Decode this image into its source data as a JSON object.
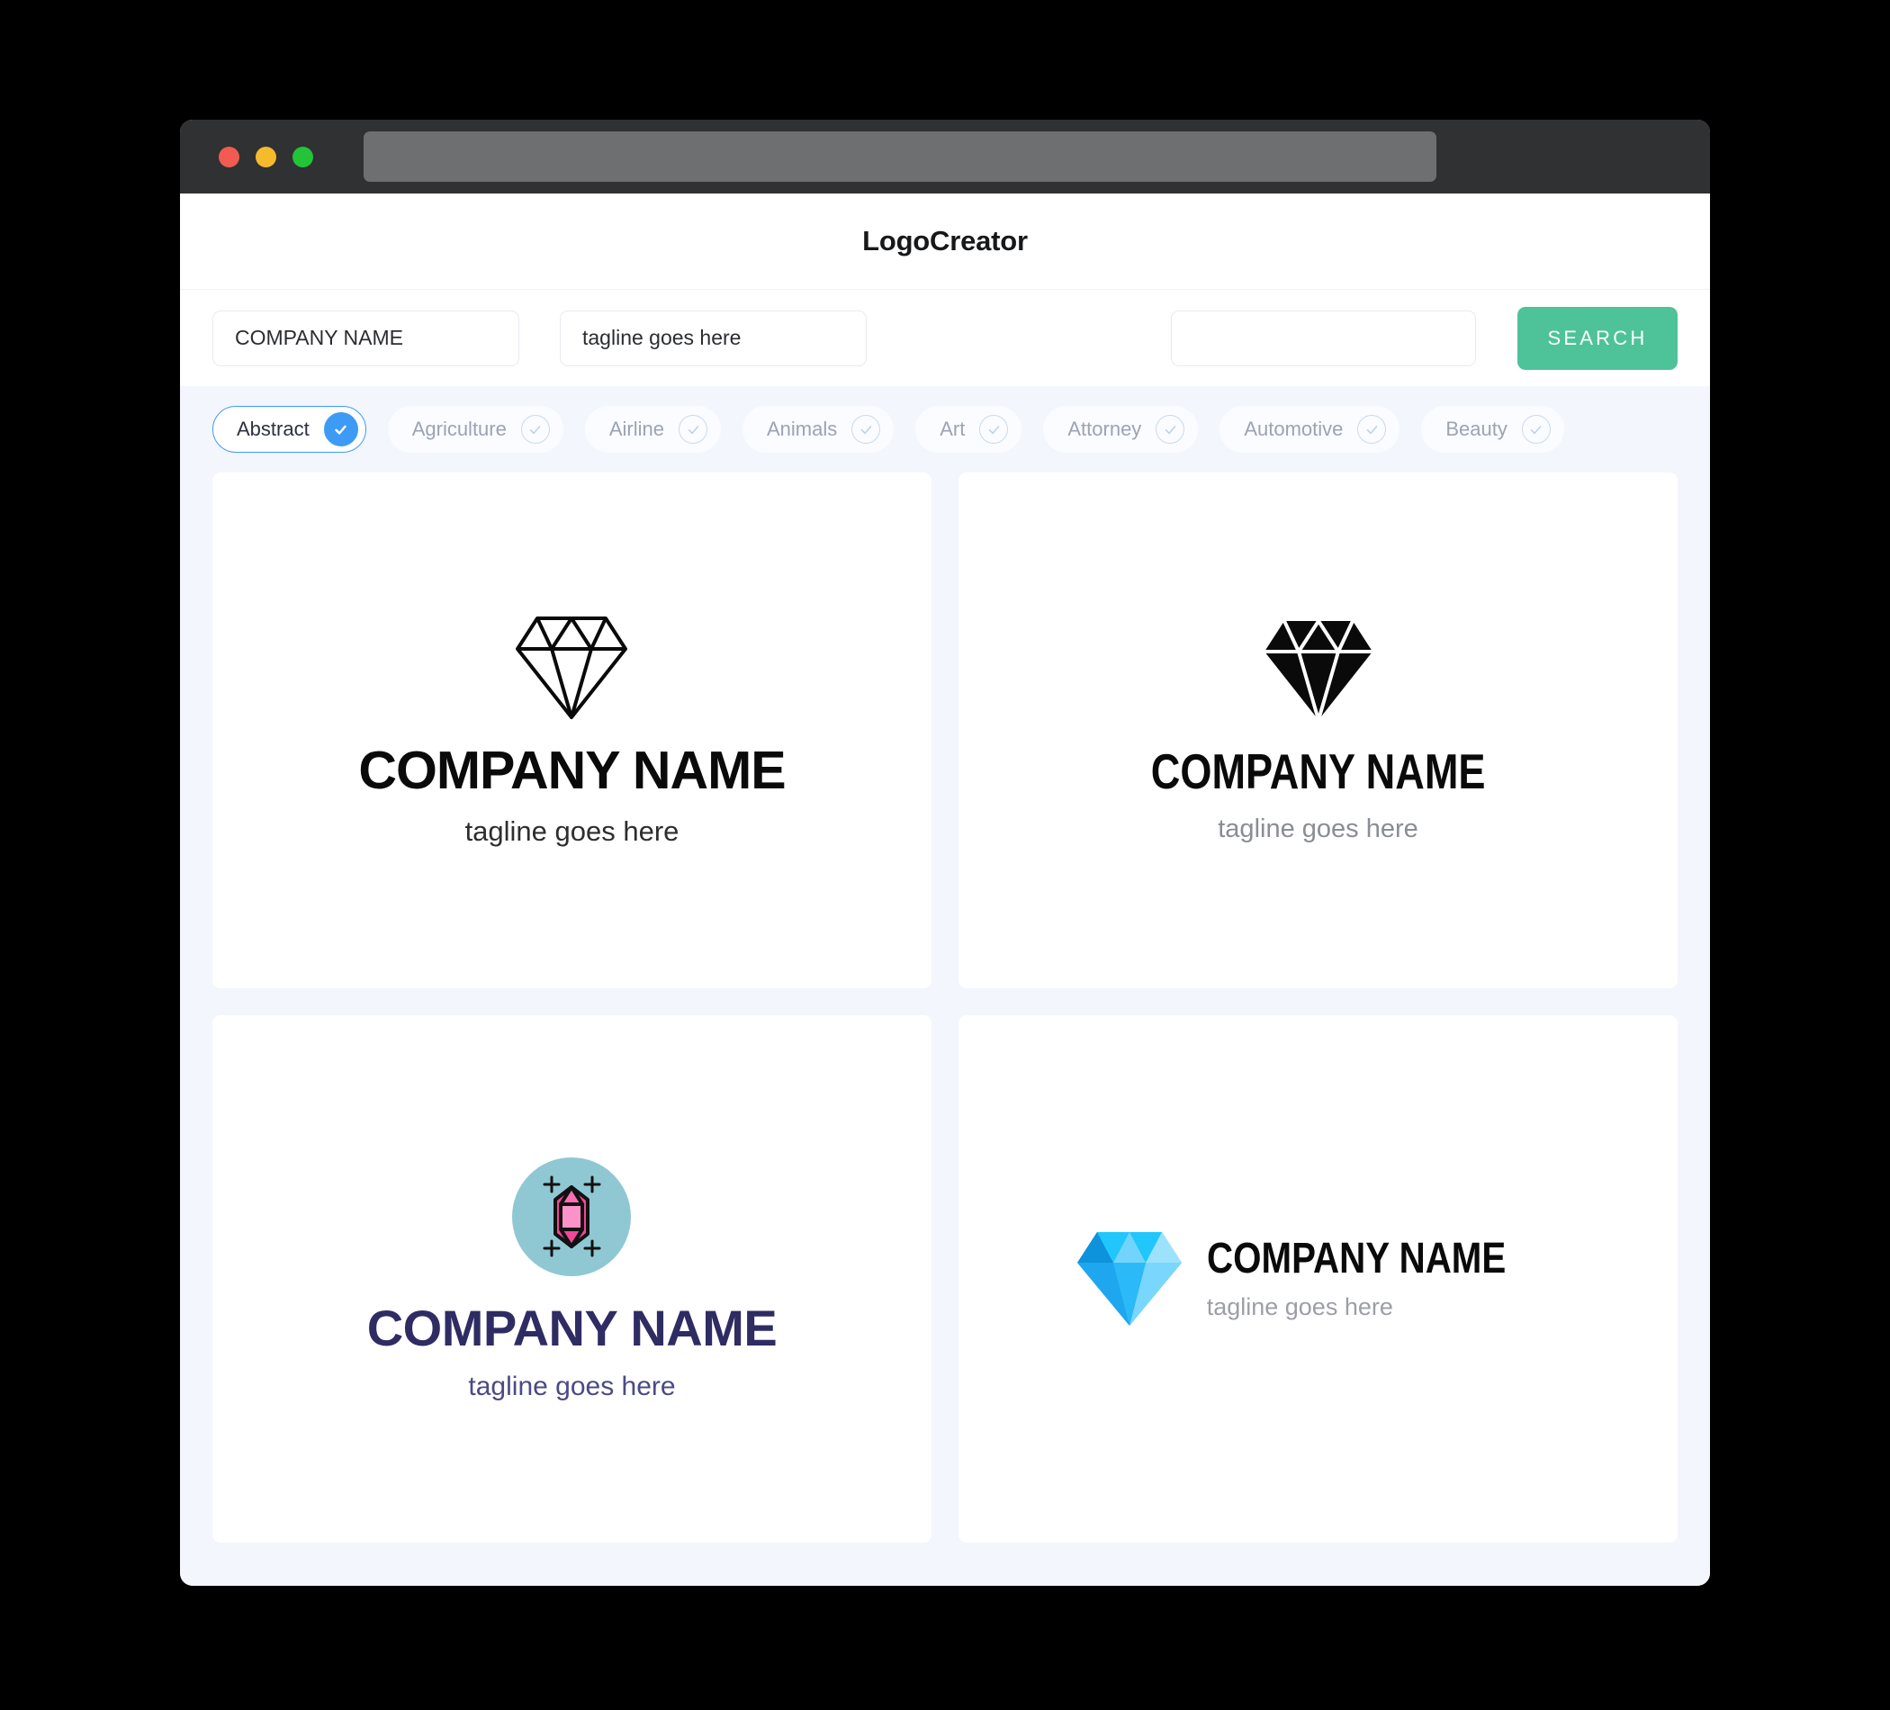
{
  "window": {
    "traffic_lights": [
      {
        "name": "close",
        "color": "#F15B52"
      },
      {
        "name": "minimize",
        "color": "#F6BA2D"
      },
      {
        "name": "maximize",
        "color": "#23C33A"
      }
    ],
    "url_value": ""
  },
  "header": {
    "title": "LogoCreator"
  },
  "search": {
    "company_value": "COMPANY NAME",
    "company_placeholder": "COMPANY NAME",
    "tagline_value": "tagline goes here",
    "tagline_placeholder": "tagline goes here",
    "extra_value": "",
    "extra_placeholder": "",
    "button_label": "SEARCH",
    "button_color": "#4EC39A"
  },
  "categories": {
    "accent_color": "#3E9BF5",
    "next_icon": "arrow-right-icon",
    "items": [
      {
        "label": "Abstract",
        "selected": true
      },
      {
        "label": "Agriculture",
        "selected": false
      },
      {
        "label": "Airline",
        "selected": false
      },
      {
        "label": "Animals",
        "selected": false
      },
      {
        "label": "Art",
        "selected": false
      },
      {
        "label": "Attorney",
        "selected": false
      },
      {
        "label": "Automotive",
        "selected": false
      },
      {
        "label": "Beauty",
        "selected": false
      }
    ]
  },
  "results": [
    {
      "id": "outline-diamond",
      "icon": "diamond-outline-icon",
      "layout": "stacked",
      "name": "COMPANY NAME",
      "tagline": "tagline goes here",
      "name_color": "#0A0A0A",
      "tagline_color": "#2E2E2E"
    },
    {
      "id": "solid-diamond",
      "icon": "diamond-solid-icon",
      "layout": "stacked",
      "name": "COMPANY NAME",
      "tagline": "tagline goes here",
      "name_color": "#0A0A0A",
      "tagline_color": "#8A8D93"
    },
    {
      "id": "pink-gem-badge",
      "icon": "gem-sparkle-circle-icon",
      "layout": "stacked",
      "name": "COMPANY NAME",
      "tagline": "tagline goes here",
      "name_color": "#2E2C63",
      "tagline_color": "#4B4A86",
      "badge_color": "#8FC8D2",
      "gem_color": "#F2479A"
    },
    {
      "id": "blue-gradient-diamond",
      "icon": "diamond-blue-gradient-icon",
      "layout": "horizontal",
      "name": "COMPANY NAME",
      "tagline": "tagline goes here",
      "name_color": "#0A0A0A",
      "tagline_color": "#9C9FA5",
      "gem_color": "#29B6F6"
    }
  ]
}
